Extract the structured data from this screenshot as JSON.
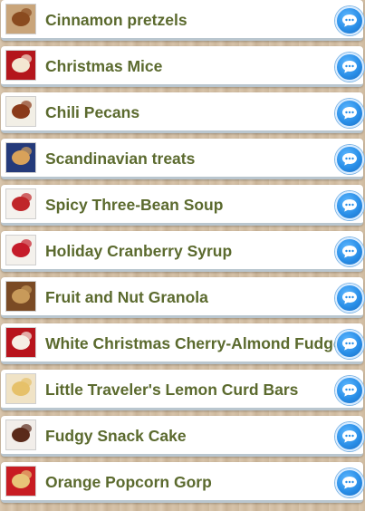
{
  "recipes": [
    {
      "title": "Cinnamon pretzels",
      "thumb_bg": "#c9a57a",
      "thumb_fg": "#8a4b1f",
      "action_icon": "chat-bubble-icon"
    },
    {
      "title": "Christmas Mice",
      "thumb_bg": "#b4161c",
      "thumb_fg": "#f3e6d2",
      "action_icon": "chat-bubble-icon"
    },
    {
      "title": "Chili Pecans",
      "thumb_bg": "#f2efe6",
      "thumb_fg": "#8a3a1a",
      "action_icon": "chat-bubble-icon"
    },
    {
      "title": "Scandinavian treats",
      "thumb_bg": "#243a7a",
      "thumb_fg": "#d8a25a",
      "action_icon": "chat-bubble-icon"
    },
    {
      "title": "Spicy Three-Bean Soup",
      "thumb_bg": "#f5f2ee",
      "thumb_fg": "#c0262a",
      "action_icon": "chat-bubble-icon"
    },
    {
      "title": "Holiday Cranberry Syrup",
      "thumb_bg": "#f4f1ec",
      "thumb_fg": "#c51c2a",
      "action_icon": "chat-bubble-icon"
    },
    {
      "title": "Fruit and Nut Granola",
      "thumb_bg": "#7a4a24",
      "thumb_fg": "#c89a5a",
      "action_icon": "chat-bubble-icon"
    },
    {
      "title": "White Christmas Cherry-Almond Fudge",
      "thumb_bg": "#b8141c",
      "thumb_fg": "#f6eee4",
      "action_icon": "chat-bubble-icon"
    },
    {
      "title": "Little Traveler's Lemon Curd Bars",
      "thumb_bg": "#f0e3c6",
      "thumb_fg": "#e6c16a",
      "action_icon": "chat-bubble-icon"
    },
    {
      "title": "Fudgy Snack Cake",
      "thumb_bg": "#f2eeea",
      "thumb_fg": "#5a2a1a",
      "action_icon": "chat-bubble-icon"
    },
    {
      "title": "Orange Popcorn Gorp",
      "thumb_bg": "#c81c22",
      "thumb_fg": "#e8c478",
      "action_icon": "chat-bubble-icon"
    }
  ],
  "colors": {
    "title_text": "#5b6a2e",
    "chat_button": "#2a8fe8",
    "row_border": "#b9c6cf"
  }
}
